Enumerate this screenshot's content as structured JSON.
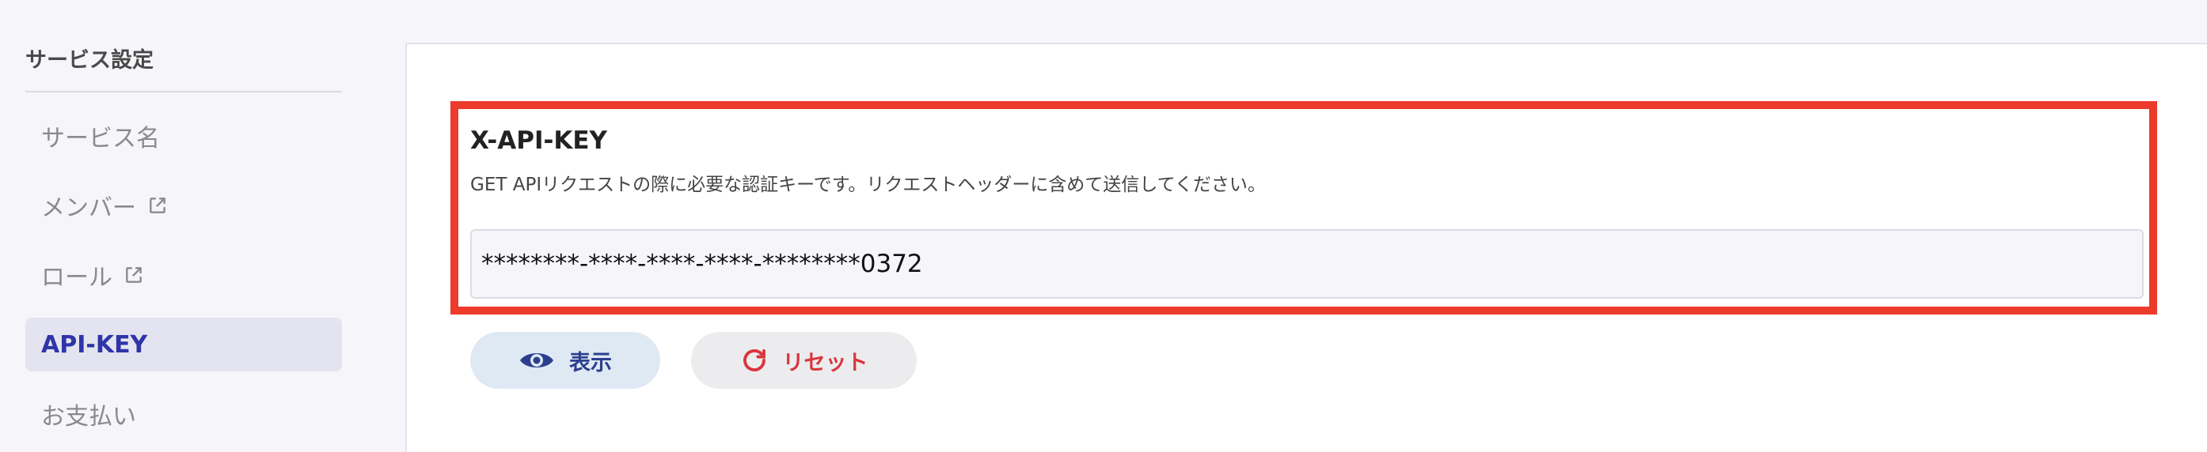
{
  "sidebar": {
    "title": "サービス設定",
    "items": [
      {
        "label": "サービス名"
      },
      {
        "label": "メンバー"
      },
      {
        "label": "ロール"
      },
      {
        "label": "API-KEY"
      },
      {
        "label": "お支払い"
      }
    ]
  },
  "main": {
    "key_title": "X-API-KEY",
    "key_description": "GET APIリクエストの際に必要な認証キーです。リクエストヘッダーに含めて送信してください。",
    "key_value": "********-****-****-****-********0372",
    "buttons": {
      "show_label": "表示",
      "reset_label": "リセット"
    }
  },
  "colors": {
    "accent": "#2f35a8",
    "highlight_border": "#ec3b2a",
    "reset": "#d9363e"
  }
}
